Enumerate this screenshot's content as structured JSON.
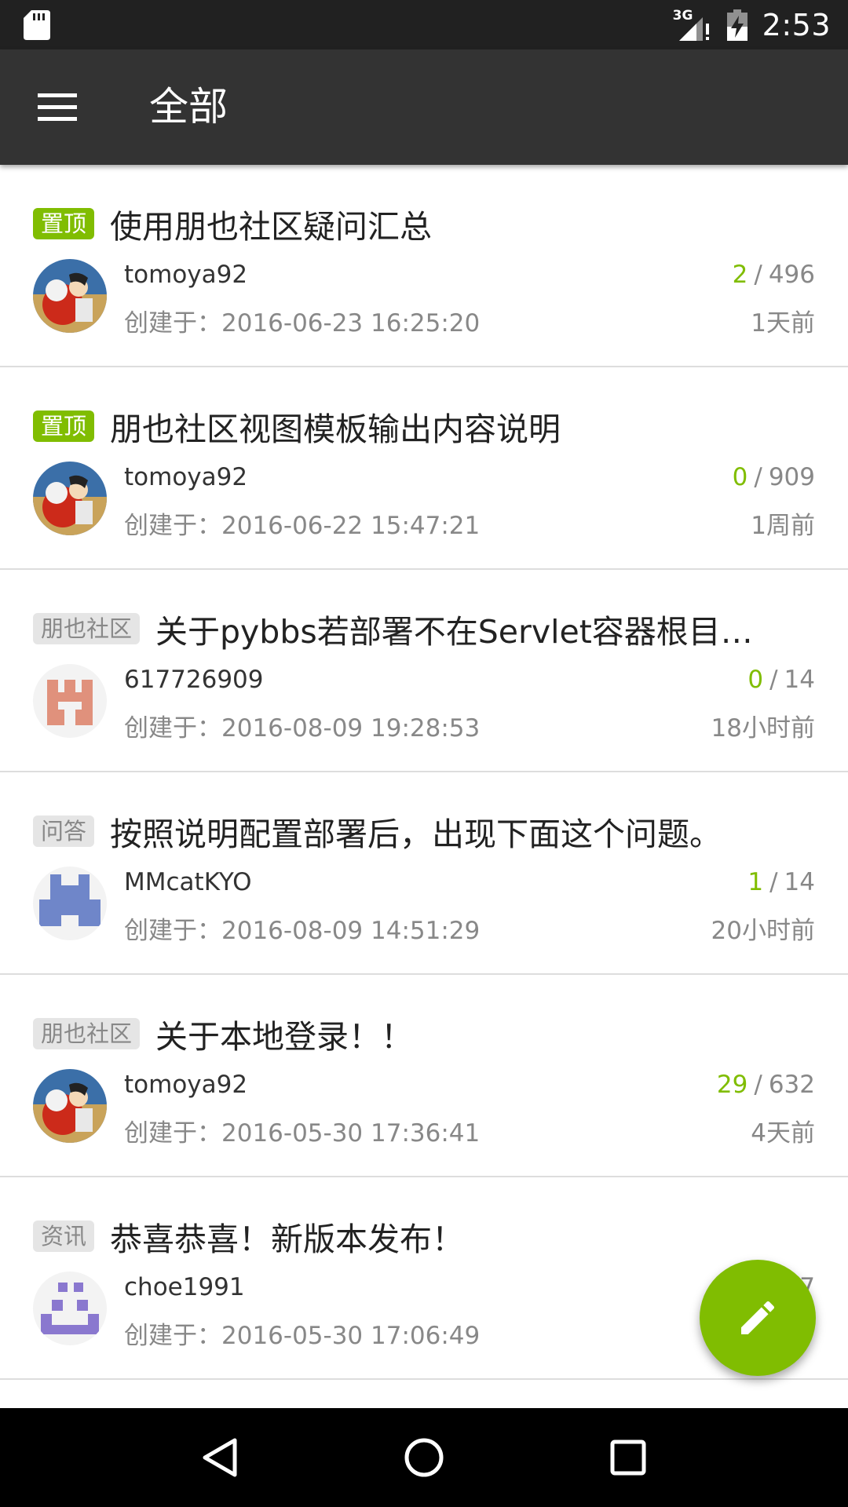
{
  "status_bar": {
    "network": "3G",
    "time": "2:53"
  },
  "toolbar": {
    "title": "全部"
  },
  "topics": [
    {
      "tab": "置顶",
      "tab_style": "top",
      "title": "使用朋也社区疑问汇总",
      "author": "tomoya92",
      "created": "创建于：2016-06-23 16:25:20",
      "replies": "2",
      "views": "496",
      "time_ago": "1天前",
      "avatar": "anime"
    },
    {
      "tab": "置顶",
      "tab_style": "top",
      "title": "朋也社区视图模板输出内容说明",
      "author": "tomoya92",
      "created": "创建于：2016-06-22 15:47:21",
      "replies": "0",
      "views": "909",
      "time_ago": "1周前",
      "avatar": "anime"
    },
    {
      "tab": "朋也社区",
      "tab_style": "normal",
      "title": "关于pybbs若部署不在Servlet容器根目录(…",
      "author": "617726909",
      "created": "创建于：2016-08-09 19:28:53",
      "replies": "0",
      "views": "14",
      "time_ago": "18小时前",
      "avatar": "identicon-salmon"
    },
    {
      "tab": "问答",
      "tab_style": "normal",
      "title": "按照说明配置部署后，出现下面这个问题。",
      "author": "MMcatKYO",
      "created": "创建于：2016-08-09 14:51:29",
      "replies": "1",
      "views": "14",
      "time_ago": "20小时前",
      "avatar": "identicon-blue"
    },
    {
      "tab": "朋也社区",
      "tab_style": "normal",
      "title": "关于本地登录！！",
      "author": "tomoya92",
      "created": "创建于：2016-05-30 17:36:41",
      "replies": "29",
      "views": "632",
      "time_ago": "4天前",
      "avatar": "anime"
    },
    {
      "tab": "资讯",
      "tab_style": "normal",
      "title": "恭喜恭喜！新版本发布！",
      "author": "choe1991",
      "created": "创建于：2016-05-30 17:06:49",
      "replies": "",
      "views": "7",
      "time_ago": "",
      "avatar": "identicon-purple"
    }
  ],
  "colors": {
    "accent": "#80bd01",
    "toolbar": "#333333",
    "status_bar": "#212121"
  },
  "icons": {
    "menu": "hamburger-menu-icon",
    "fab": "pencil-edit-icon",
    "nav_back": "triangle-back-icon",
    "nav_home": "circle-home-icon",
    "nav_recents": "square-recents-icon"
  }
}
